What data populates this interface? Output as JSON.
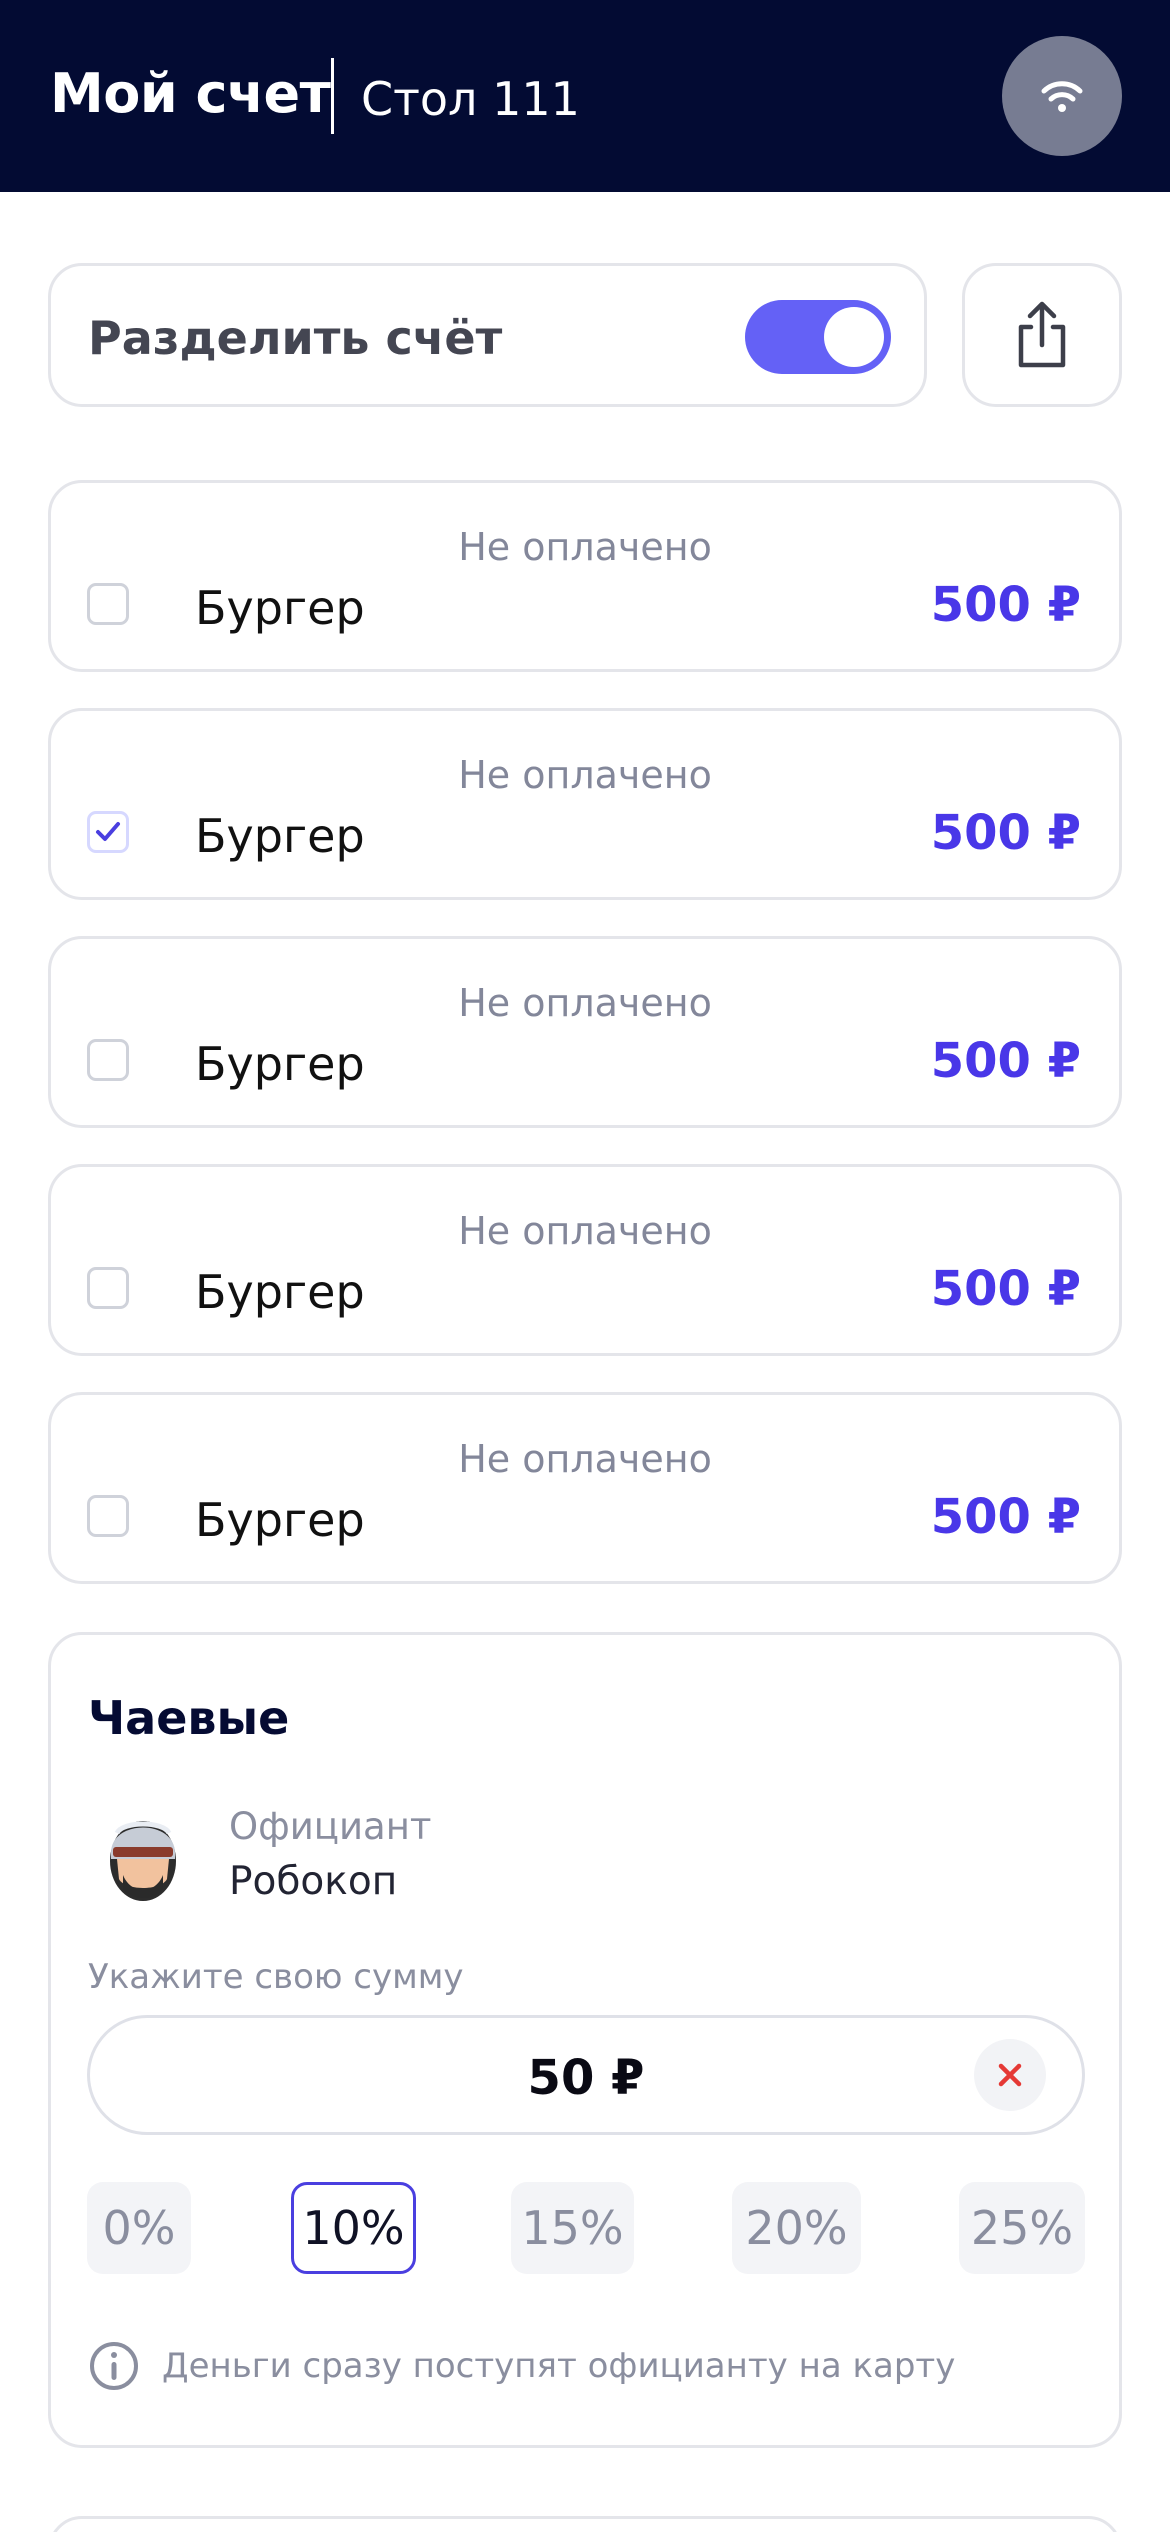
{
  "header": {
    "title": "Мой счет",
    "table": "Стол 111",
    "wifi_icon": "wifi-icon"
  },
  "split": {
    "label": "Разделить счёт",
    "toggle_on": true,
    "share_icon": "share-icon"
  },
  "items": [
    {
      "status": "Не оплачено",
      "name": "Бургер",
      "price": "500 ₽",
      "checked": false
    },
    {
      "status": "Не оплачено",
      "name": "Бургер",
      "price": "500 ₽",
      "checked": true
    },
    {
      "status": "Не оплачено",
      "name": "Бургер",
      "price": "500 ₽",
      "checked": false
    },
    {
      "status": "Не оплачено",
      "name": "Бургер",
      "price": "500 ₽",
      "checked": false
    },
    {
      "status": "Не оплачено",
      "name": "Бургер",
      "price": "500 ₽",
      "checked": false
    }
  ],
  "tips": {
    "title": "Чаевые",
    "waiter_role": "Официант",
    "waiter_name": "Робокоп",
    "amount_label": "Укажите свою сумму",
    "amount_value": "50 ₽",
    "percentages": [
      "0%",
      "10%",
      "15%",
      "20%",
      "25%"
    ],
    "selected_percentage": "10%",
    "info_text": "Деньги сразу поступят официанту на карту"
  },
  "colors": {
    "header_bg": "#030b33",
    "accent": "#6461f6",
    "price": "#4937e8",
    "clear_x": "#e53935"
  }
}
